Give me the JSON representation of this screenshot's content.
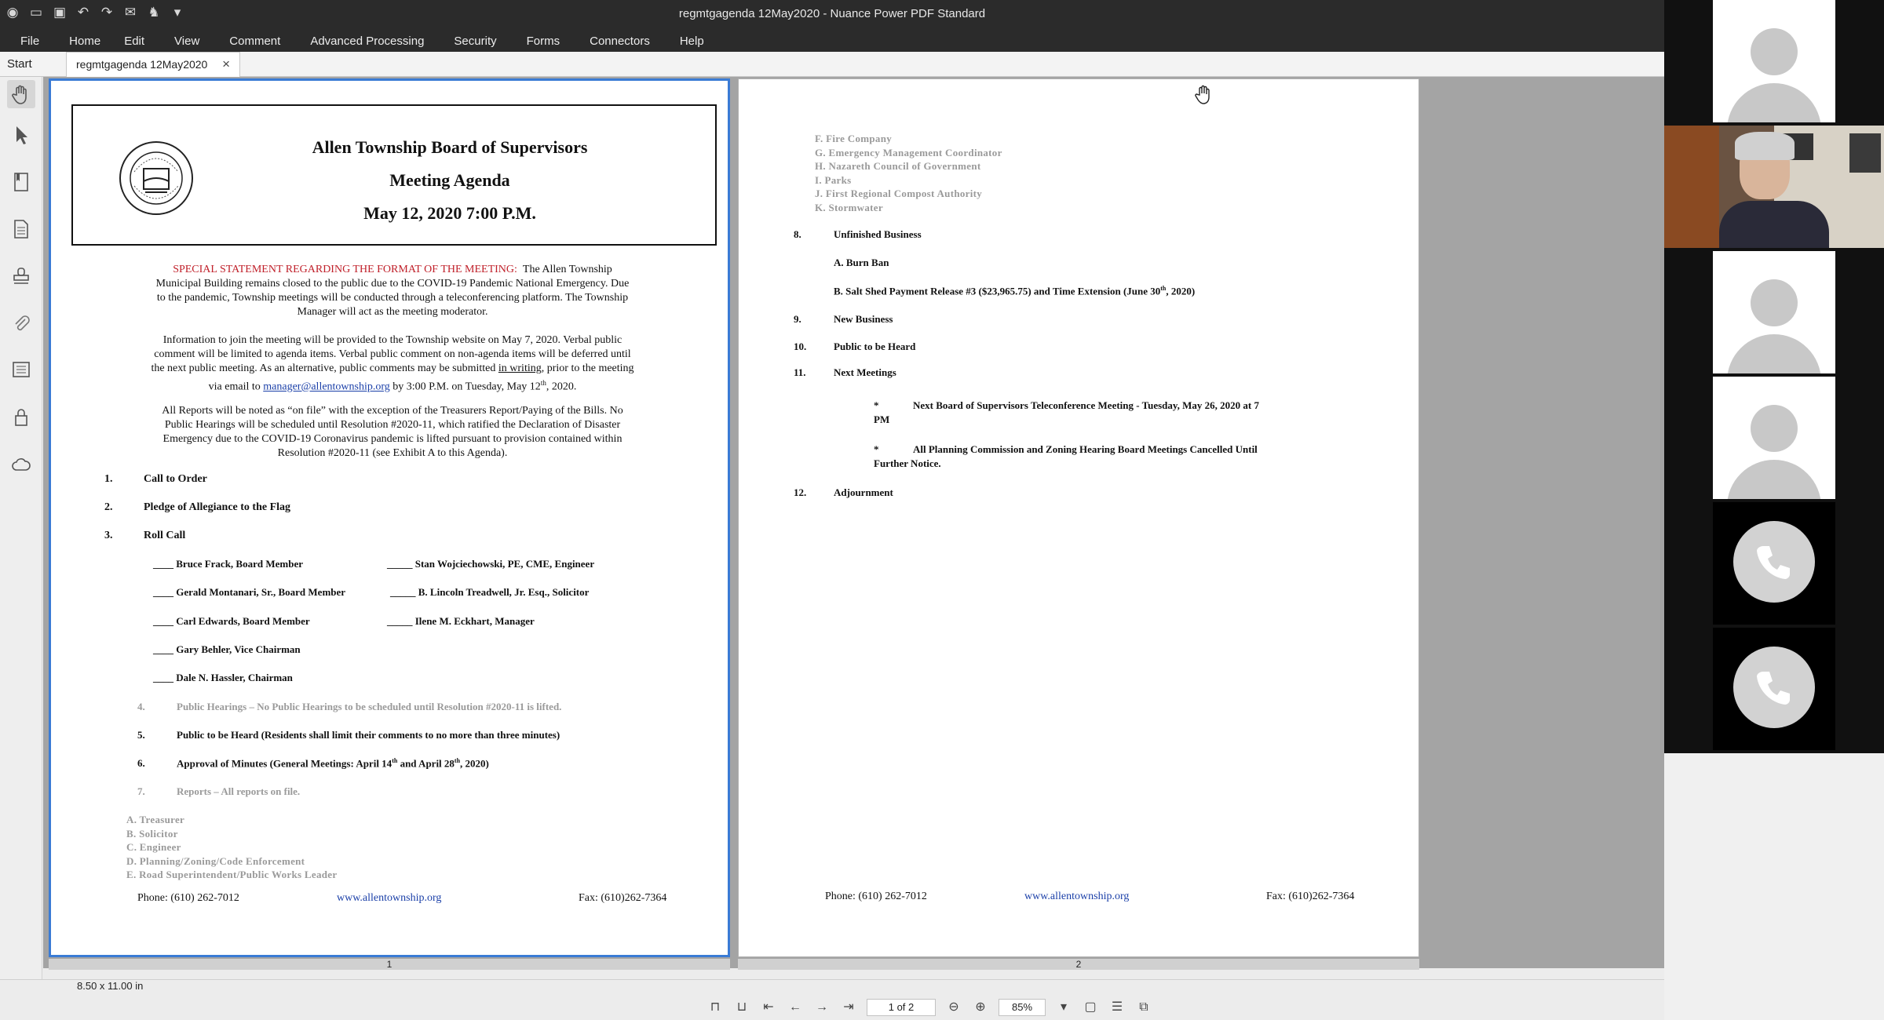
{
  "app": {
    "title": "regmtgagenda 12May2020 - Nuance Power PDF Standard",
    "menu": [
      "File",
      "Home",
      "Edit",
      "View",
      "Comment",
      "Advanced Processing",
      "Security",
      "Forms",
      "Connectors",
      "Help"
    ],
    "start_tab": "Start",
    "doc_tab": "regmtgagenda 12May2020",
    "close_glyph": "×"
  },
  "page1": {
    "header": {
      "line1": "Allen Township Board of Supervisors",
      "line2": "Meeting Agenda",
      "line3": "May 12, 2020 7:00 P.M."
    },
    "special_label": "SPECIAL STATEMENT REGARDING THE FORMAT OF THE MEETING:",
    "special_text_1": "The Allen Township",
    "special_text_2": "Municipal Building remains closed to the public due to the COVID-19 Pandemic National Emergency.  Due",
    "special_text_3": "to the pandemic, Township meetings will be conducted through a teleconferencing platform.  The Township",
    "special_text_4": "Manager will act as the meeting moderator.",
    "info_1": "Information to join the meeting will be provided to the Township website on May 7, 2020.  Verbal public",
    "info_2": "comment will be limited to agenda items.  Verbal public comment on non-agenda items will be deferred until",
    "info_3a": "the next public meeting. As an alternative, public comments may be submitted",
    "info_3b": "in writing",
    "info_3c": ", prior to the meeting",
    "info_4a": "via email to",
    "info_4b": "manager@allentownship.org",
    "info_4c": "by 3:00 P.M. on Tuesday, May 12",
    "info_4d": "th",
    "info_4e": ", 2020.",
    "reports_1": "All Reports will be noted as “on file” with the exception of the Treasurers Report/Paying of the Bills.  No",
    "reports_2": "Public Hearings will be scheduled until Resolution #2020-11, which ratified the Declaration of Disaster",
    "reports_3": "Emergency due to the COVID-19 Coronavirus pandemic is lifted pursuant to provision contained within",
    "reports_4": "Resolution #2020-11 (see Exhibit A to this Agenda).",
    "items": [
      {
        "num": "1.",
        "text": "Call to Order"
      },
      {
        "num": "2.",
        "text": "Pledge of Allegiance to the Flag"
      },
      {
        "num": "3.",
        "text": "Roll Call"
      }
    ],
    "roll_left": [
      "____ Bruce Frack, Board Member",
      "____ Gerald Montanari, Sr., Board Member",
      "____ Carl Edwards, Board Member",
      "____ Gary Behler, Vice Chairman",
      "____ Dale N. Hassler, Chairman"
    ],
    "roll_right": [
      "_____ Stan Wojciechowski, PE, CME, Engineer",
      "_____ B. Lincoln Treadwell, Jr. Esq., Solicitor",
      "_____ Ilene M. Eckhart, Manager"
    ],
    "item4_num": "4.",
    "item4_text": "Public Hearings – No Public Hearings to be scheduled until Resolution #2020-11 is lifted.",
    "item5_num": "5.",
    "item5_text": "Public to be Heard (Residents shall limit their comments to no more than three minutes)",
    "item6_num": "6.",
    "item6_text_a": "Approval of Minutes (General Meetings: April 14",
    "item6_sup1": "th",
    "item6_text_b": " and April 28",
    "item6_sup2": "th",
    "item6_text_c": ", 2020)",
    "item7_num": "7.",
    "item7_text": "Reports – All reports on file.",
    "reports_list": [
      "A.  Treasurer",
      "B.  Solicitor",
      "C.  Engineer",
      "D.  Planning/Zoning/Code Enforcement",
      "E.  Road Superintendent/Public Works Leader"
    ],
    "phone": "Phone: (610) 262-7012",
    "web": "www.allentownship.org",
    "fax": "Fax: (610)262-7364",
    "page_num": "1"
  },
  "page2": {
    "reports_cont": [
      "F.  Fire Company",
      "G.  Emergency Management Coordinator",
      "H.  Nazareth Council of Government",
      "I.   Parks",
      "J.   First Regional Compost Authority",
      "K.  Stormwater"
    ],
    "item8_num": "8.",
    "item8_text": "Unfinished Business",
    "item8a": "A.  Burn Ban",
    "item8b_a": "B.  Salt Shed Payment Release #3 ($23,965.75) and Time Extension (June 30",
    "item8b_sup": "th",
    "item8b_c": ", 2020)",
    "item9_num": "9.",
    "item9_text": "New Business",
    "item10_num": "10.",
    "item10_text": "Public to be Heard",
    "item11_num": "11.",
    "item11_text": "Next Meetings",
    "next1_bullet": "*",
    "next1_a": "Next Board of Supervisors Teleconference Meeting -  Tuesday, May 26, 2020 at 7",
    "next1_b": "PM",
    "next2_bullet": "*",
    "next2_a": "All Planning Commission and Zoning Hearing Board Meetings Cancelled Until",
    "next2_b": "Further Notice.",
    "item12_num": "12.",
    "item12_text": "Adjournment",
    "phone": "Phone: (610) 262-7012",
    "web": "www.allentownship.org",
    "fax": "Fax: (610)262-7364",
    "page_num": "2"
  },
  "status": {
    "page_size": "8.50 x 11.00 in",
    "page_indicator": "1 of 2",
    "zoom": "85%"
  },
  "colors": {
    "accent_blue": "#3a7bd5",
    "red_text": "#c0202a",
    "gray_text": "#9a9a9a"
  }
}
